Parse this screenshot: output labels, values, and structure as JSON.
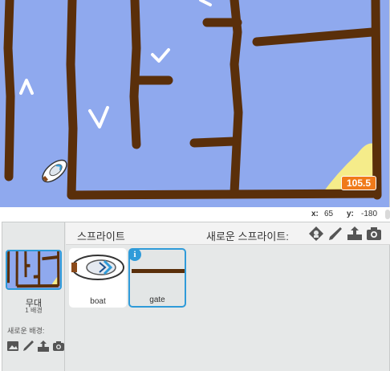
{
  "stage": {
    "timer_value": "105.5",
    "colors": {
      "water": "#8fa9ee",
      "wall": "#5a2f0a",
      "sand": "#f5ec8a",
      "timer": "#f07a1a"
    }
  },
  "coords": {
    "x_label": "x:",
    "x_value": "65",
    "y_label": "y:",
    "y_value": "-180"
  },
  "sprites_panel": {
    "title": "스프라이트",
    "new_sprite_label": "새로운 스프라이트:",
    "tools": [
      "character-library-icon",
      "paint-brush-icon",
      "upload-icon",
      "camera-icon"
    ],
    "sprites": [
      {
        "name": "boat",
        "selected": false
      },
      {
        "name": "gate",
        "selected": true
      }
    ]
  },
  "stage_panel": {
    "label": "무대",
    "count": "1 배경",
    "new_backdrop_label": "새로운 배경:",
    "tools": [
      "image-library-icon",
      "paint-brush-icon",
      "upload-icon",
      "camera-icon"
    ]
  },
  "accent": "#2f9bd9"
}
